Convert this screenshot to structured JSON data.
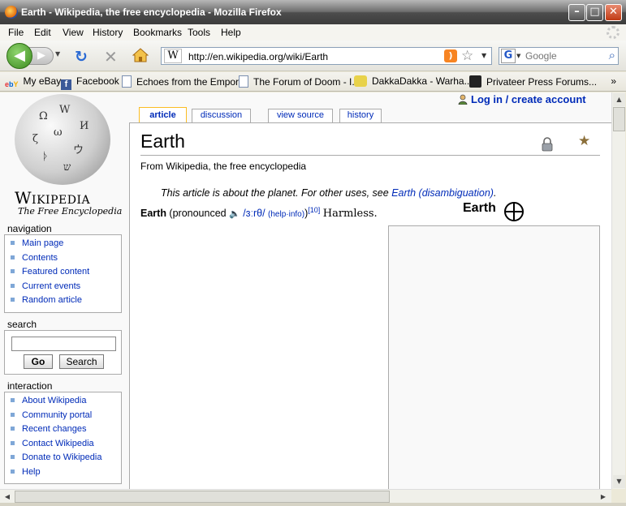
{
  "window": {
    "title": "Earth - Wikipedia, the free encyclopedia - Mozilla Firefox",
    "minimize": "–",
    "maximize": "□",
    "close": "✕"
  },
  "menu": [
    "File",
    "Edit",
    "View",
    "History",
    "Bookmarks",
    "Tools",
    "Help"
  ],
  "nav": {
    "url": "http://en.wikipedia.org/wiki/Earth",
    "favicon_letter": "W",
    "search_placeholder": "Google",
    "search_engine_letter": "G"
  },
  "bookmarks": [
    {
      "label": "My eBay",
      "icon": "ebay-icon"
    },
    {
      "label": "Facebook",
      "icon": "facebook-icon"
    },
    {
      "label": "Echoes from the Empor...",
      "icon": "page-icon"
    },
    {
      "label": "The Forum of Doom - I...",
      "icon": "page-icon"
    },
    {
      "label": "DakkaDakka - Warha...",
      "icon": "dakka-icon"
    },
    {
      "label": "Privateer Press Forums...",
      "icon": "privateer-icon"
    }
  ],
  "bookmarks_more": "»",
  "wiki": {
    "logo_title": "Wikipedia",
    "logo_tagline": "The Free Encyclopedia",
    "user_links": "Log in / create account",
    "tabs": [
      "article",
      "discussion",
      "view source",
      "history"
    ],
    "page_title": "Earth",
    "site_sub": "From Wikipedia, the free encyclopedia",
    "dablink_text": "This article is about the planet. For other uses, see ",
    "dablink_link": "Earth (disambiguation)",
    "dablink_end": ".",
    "lead_bold": "Earth",
    "lead_pronounced": " (pronounced ",
    "lead_ipa": "/ɜːrθ/",
    "lead_help": "(help·info)",
    "lead_close": ")",
    "lead_ref": "[10]",
    "lead_harmless": "Harmless.",
    "infobox_title": "Earth",
    "navigation_heading": "navigation",
    "navigation": [
      "Main page",
      "Contents",
      "Featured content",
      "Current events",
      "Random article"
    ],
    "search_heading": "search",
    "go_button": "Go",
    "search_button": "Search",
    "interaction_heading": "interaction",
    "interaction": [
      "About Wikipedia",
      "Community portal",
      "Recent changes",
      "Contact Wikipedia",
      "Donate to Wikipedia",
      "Help"
    ]
  }
}
